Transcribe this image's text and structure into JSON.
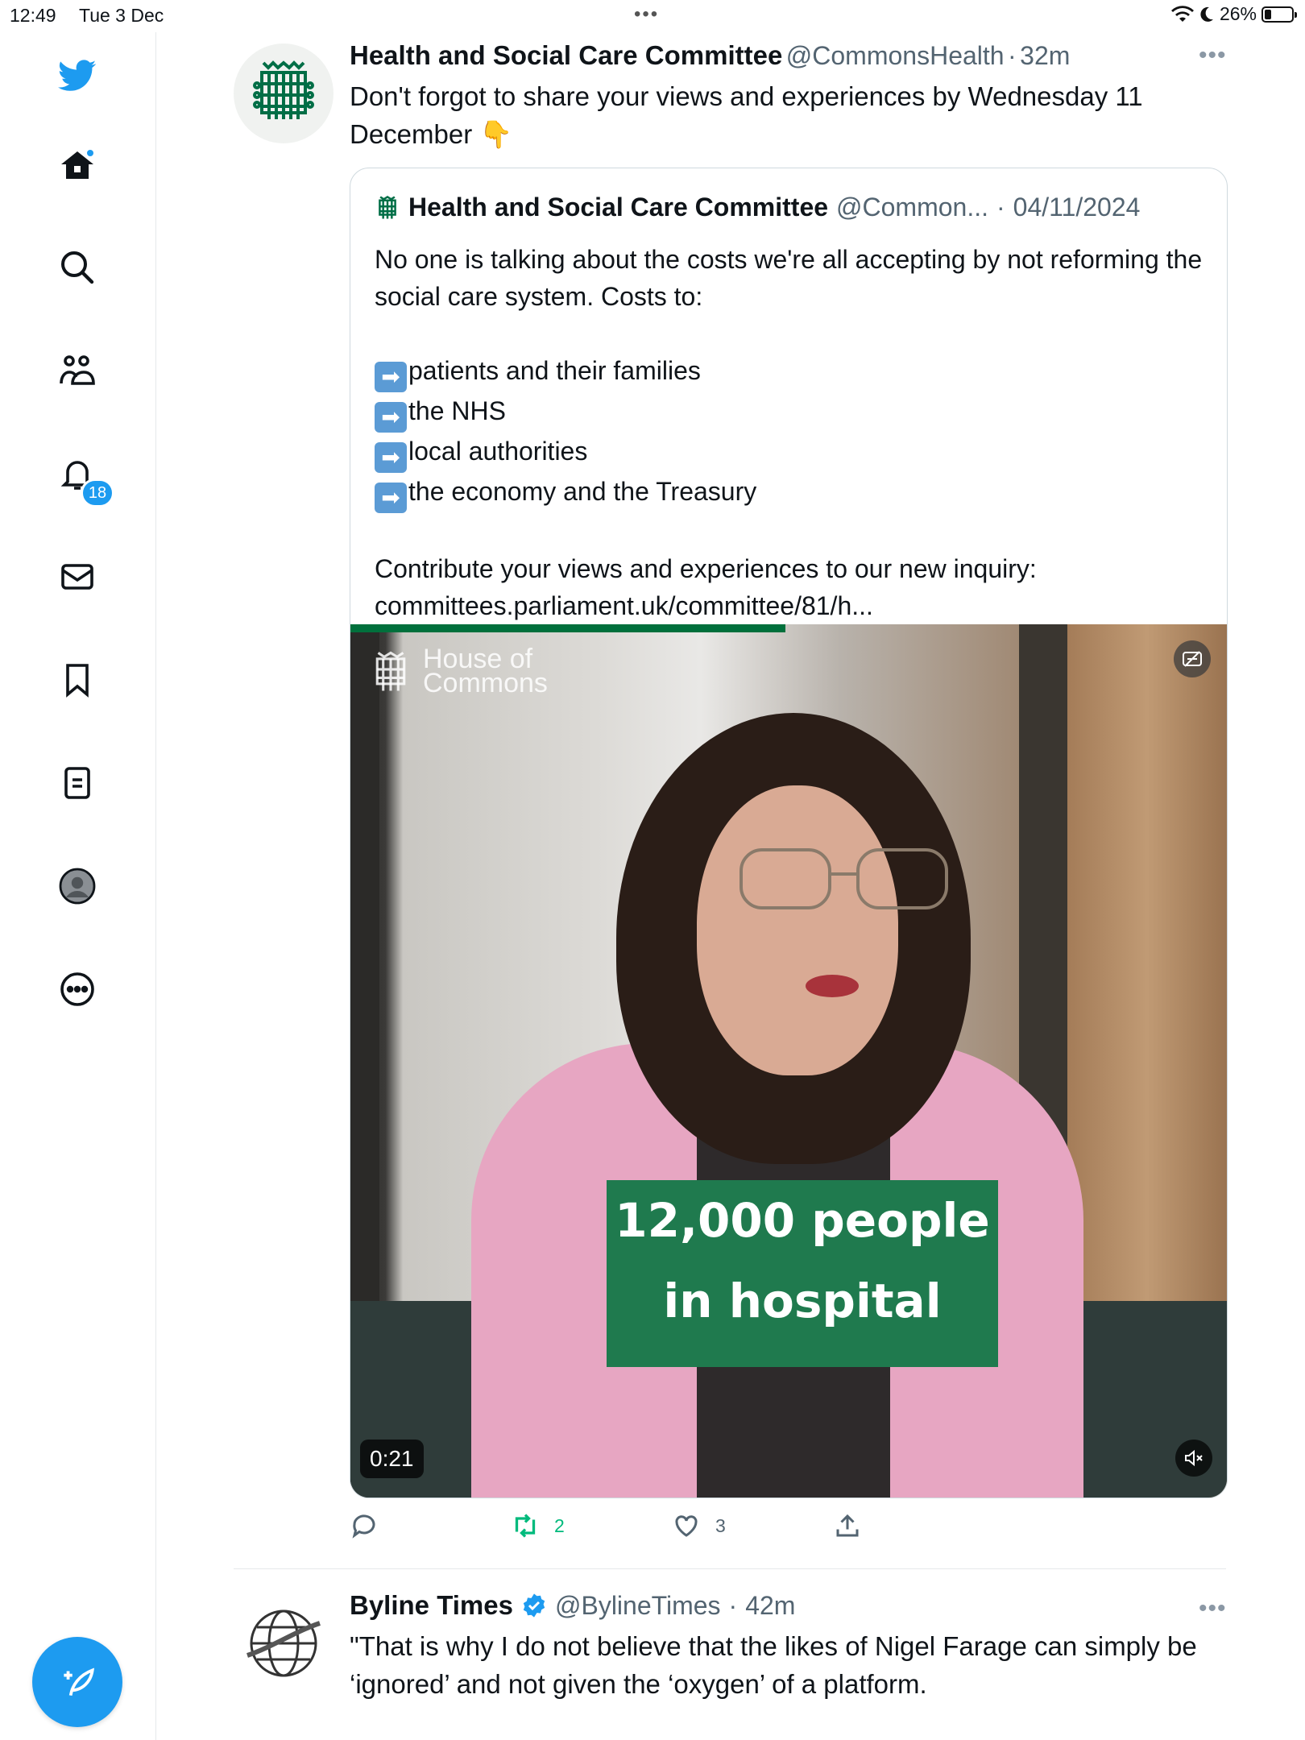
{
  "status_bar": {
    "time": "12:49",
    "date": "Tue 3 Dec",
    "battery": "26%",
    "battery_level": 0.26
  },
  "sidebar": {
    "items": [
      {
        "icon": "twitter-bird-icon"
      },
      {
        "icon": "home-icon"
      },
      {
        "icon": "search-icon"
      },
      {
        "icon": "communities-icon"
      },
      {
        "icon": "notifications-bell-icon",
        "badge": "18"
      },
      {
        "icon": "messages-envelope-icon"
      },
      {
        "icon": "bookmark-icon"
      },
      {
        "icon": "lists-icon"
      },
      {
        "icon": "profile-avatar-icon"
      },
      {
        "icon": "more-circle-icon"
      }
    ],
    "compose_icon": "compose-feather-icon",
    "accent": "#1d9bf0"
  },
  "tweet1": {
    "name": "Health and Social Care Committee",
    "handle": "@CommonsHealth",
    "separator": "·",
    "time": "32m",
    "text": "Don't forgot to share your views and experiences by Wednesday 11 December",
    "emoji": "👇",
    "quote": {
      "name": "Health and Social Care Committee",
      "handle": "@Common...",
      "separator": "·",
      "date": "04/11/2024",
      "line1": "No one is talking about the costs we're all accepting by not reforming the social care system. Costs to:",
      "bullets": [
        "patients and their families",
        "the NHS",
        "local authorities",
        "the economy and the Treasury"
      ],
      "line2": "Contribute your views and experiences to our new inquiry:",
      "link": "committees.parliament.uk/committee/81/h...",
      "video": {
        "logo_line1": "House of",
        "logo_line2": "Commons",
        "caption_line1": "12,000 people",
        "caption_line2": "in hospital",
        "duration": "0:21"
      }
    },
    "actions": {
      "reply_count": "",
      "retweet_count": "2",
      "like_count": "3"
    }
  },
  "tweet2": {
    "name": "Byline Times",
    "handle": "@BylineTimes",
    "separator": "·",
    "time": "42m",
    "text": "\"That is why I do not believe that the likes of Nigel Farage can simply be ‘ignored’ and not given the ‘oxygen’ of a platform."
  },
  "colors": {
    "accent": "#1d9bf0",
    "retweet_green": "#00ba7c",
    "commons_green": "#006e46",
    "caption_green": "#1f7a4e"
  }
}
